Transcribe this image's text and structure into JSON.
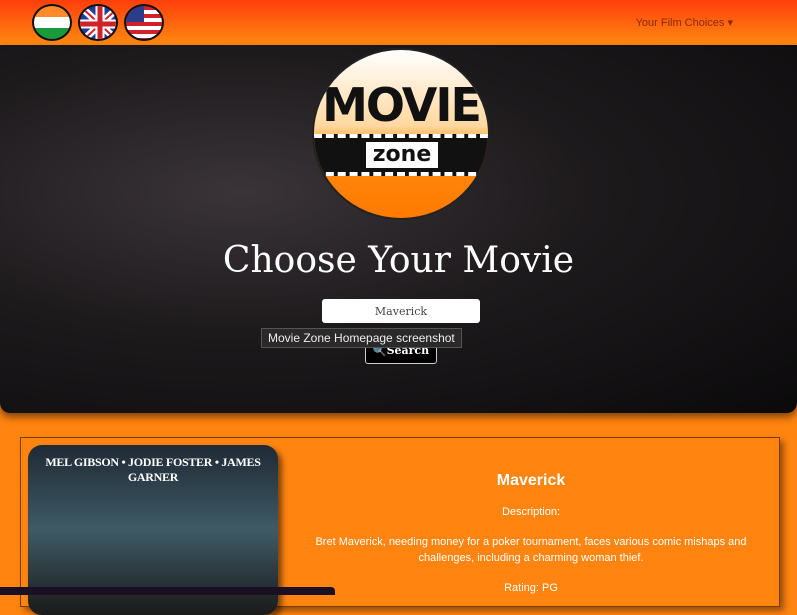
{
  "nav": {
    "flags": [
      "India",
      "United Kingdom",
      "United States"
    ],
    "menu_label": "Your Film Choices"
  },
  "hero": {
    "logo_text": "MOVIE zone",
    "title": "Choose Your Movie",
    "search_value": "Maverick",
    "search_button": "Search",
    "tooltip": "Movie Zone Homepage screenshot"
  },
  "movie": {
    "poster_cast": "MEL GIBSON • JODIE FOSTER • JAMES GARNER",
    "title": "Maverick",
    "description_label": "Description:",
    "description": "Bret Maverick, needing money for a poker tournament, faces various comic mishaps and challenges, including a charming woman thief.",
    "rating": "Rating: PG"
  }
}
